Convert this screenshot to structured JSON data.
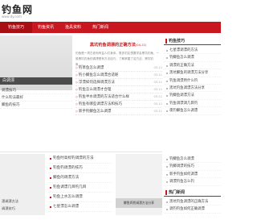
{
  "header": {
    "logo_text": "钓鱼网",
    "logo_url": "www.dy.com"
  },
  "nav": [
    "钓鱼技巧",
    "钓鱼资讯",
    "渔具资料",
    "热门新闻"
  ],
  "slide": {
    "caption": "白调漂",
    "rows": [
      "调漂技巧",
      "什么钓法最好",
      "鲫鱼的技巧"
    ]
  },
  "headline": {
    "title": "黑坑钓鱼调漂的正确方法",
    "title_suffix": "(04-11)",
    "desc": "钓鱼是一项古老而有益人们身体，很多钓友想要学会黑坑钓鱼，一般黑坑钓鱼的调漂是有方法技巧，了解掌握了这方法，黑坑钓鱼......"
  },
  "news": [
    {
      "title": "钓草鱼怎么调漂",
      "date": "05-11"
    },
    {
      "title": "钓小鲫鱼怎么调漂合适呢",
      "date": "05-11"
    },
    {
      "title": "浮漂如何选择调漂方法",
      "date": "05-11"
    },
    {
      "title": "钓鱼怎么调漂才合理",
      "date": "05-11"
    },
    {
      "title": "钓鱼半水调漂的方法适合什么样",
      "date": "05-11"
    },
    {
      "title": "钓鱼有哪些调漂方法和技巧",
      "date": "05-11"
    },
    {
      "title": "新手钓鲫鱼怎么调漂",
      "date": "05-11"
    }
  ],
  "sidebar_top": {
    "heading": "钓鱼技巧",
    "items": [
      "七星漂调漂的方法",
      "钓鲫鱼怎么调漂",
      "调漂的正确方法",
      "黑坑鲫鱼的调漂方法分享",
      "钓鱼调漂用什么钓",
      "黑坑钓鱼调漂方法分享",
      "钓鲫鱼调漂方法",
      "钓鱼调漂调几目钓",
      "夜钓鲫鱼怎么调漂"
    ]
  },
  "lower_list": [
    "钓鱼时高标钓调漂的方法",
    "钓鱼钓调漂的技巧",
    "鲫鱼的调漂方法",
    "钓鱼调漂几目钓几目",
    "钓鱼上水怎么调漂",
    "七星漂怎么调漂",
    "鱼漂的大全怎么调漂"
  ],
  "lower_left": [
    "漂调漂方法",
    "调漂技巧"
  ],
  "lower_right_list": [
    "钓鲫鱼怎么调漂",
    "钓鲫调漂的技巧",
    "新手钓鱼如何调漂",
    "调漂钓鱼怎么钓"
  ],
  "banner": "鲫鱼四到调漂方法分享",
  "hot": {
    "heading": "热门新闻",
    "items": [
      "黑坑钓鱼调漂的正确方法",
      "调钓钓鱼如何正确调漂"
    ]
  }
}
